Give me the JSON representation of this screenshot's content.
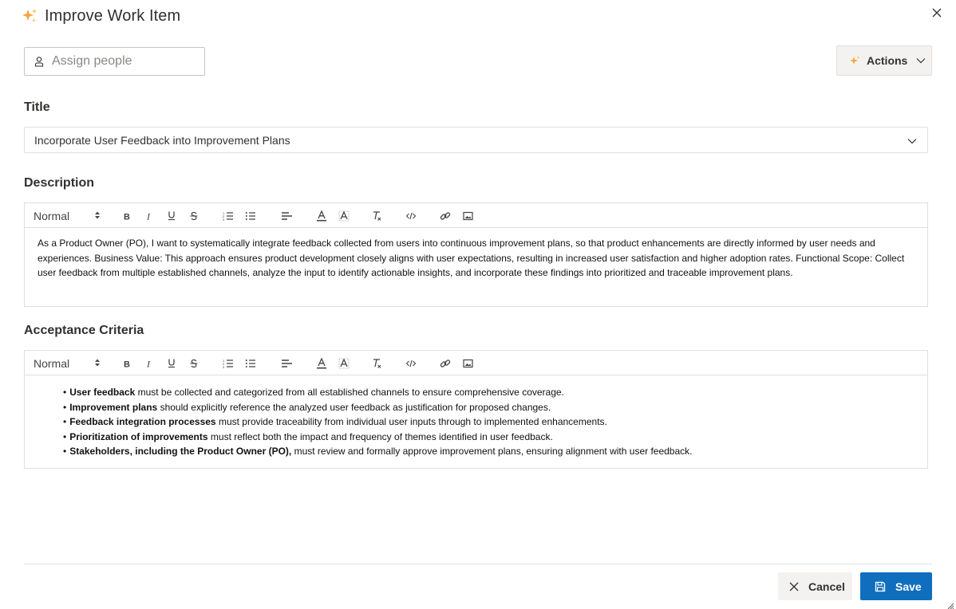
{
  "dialog": {
    "title": "Improve Work Item",
    "icon": "sparkles-icon",
    "close_icon": "close-icon"
  },
  "assign": {
    "placeholder": "Assign people",
    "icon": "person-icon"
  },
  "actions": {
    "label": "Actions",
    "icon": "sparkles-icon"
  },
  "fields": {
    "title_label": "Title",
    "title_value": "Incorporate User Feedback into Improvement Plans",
    "description_label": "Description",
    "acceptance_label": "Acceptance Criteria"
  },
  "toolbar": {
    "format": "Normal",
    "buttons": [
      "bold",
      "italic",
      "underline",
      "strikethrough",
      "ordered-list",
      "bullet-list",
      "align",
      "text-color",
      "highlight",
      "clear-format",
      "code",
      "link",
      "image"
    ]
  },
  "description": {
    "text": "As a Product Owner (PO), I want to systematically integrate feedback collected from users into continuous improvement plans, so that product enhancements are directly informed by user needs and experiences. Business Value: This approach ensures product development closely aligns with user expectations, resulting in increased user satisfaction and higher adoption rates. Functional Scope: Collect user feedback from multiple established channels, analyze the input to identify actionable insights, and incorporate these findings into prioritized and traceable improvement plans."
  },
  "acceptance": {
    "items": [
      {
        "bold": "User feedback",
        "rest": " must be collected and categorized from all established channels to ensure comprehensive coverage."
      },
      {
        "bold": "Improvement plans",
        "rest": " should explicitly reference the analyzed user feedback as justification for proposed changes."
      },
      {
        "bold": "Feedback integration processes",
        "rest": " must provide traceability from individual user inputs through to implemented enhancements."
      },
      {
        "bold": "Prioritization of improvements",
        "rest": " must reflect both the impact and frequency of themes identified in user feedback."
      },
      {
        "bold": "Stakeholders, including the Product Owner (PO),",
        "rest": " must review and formally approve improvement plans, ensuring alignment with user feedback."
      }
    ]
  },
  "footer": {
    "cancel_label": "Cancel",
    "save_label": "Save"
  },
  "colors": {
    "primary": "#106ebe",
    "sparkle": "#f5b247",
    "border": "#e1dfdd"
  }
}
